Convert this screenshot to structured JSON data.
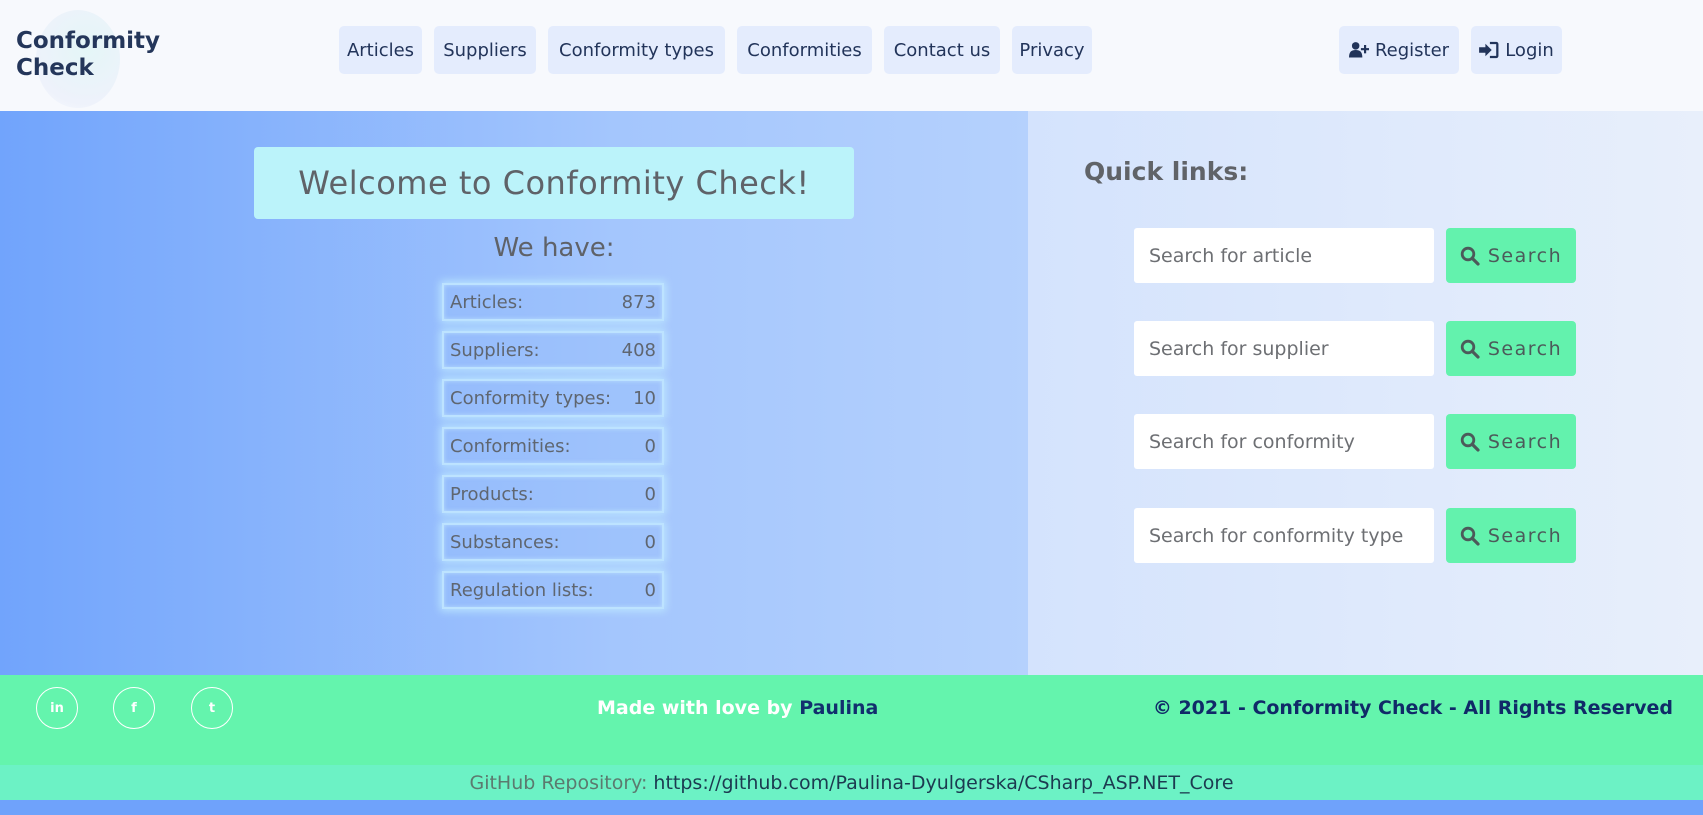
{
  "header": {
    "brand_line1": "Conformity",
    "brand_line2": "Check",
    "nav": [
      "Articles",
      "Suppliers",
      "Conformity types",
      "Conformities",
      "Contact us",
      "Privacy"
    ],
    "register": "Register",
    "login": "Login"
  },
  "hero": {
    "welcome": "Welcome to Conformity Check!",
    "we_have": "We have:",
    "stats": [
      {
        "label": "Articles:",
        "value": "873"
      },
      {
        "label": "Suppliers:",
        "value": "408"
      },
      {
        "label": "Conformity types:",
        "value": "10"
      },
      {
        "label": "Conformities:",
        "value": "0"
      },
      {
        "label": "Products:",
        "value": "0"
      },
      {
        "label": "Substances:",
        "value": "0"
      },
      {
        "label": "Regulation lists:",
        "value": "0"
      }
    ]
  },
  "quick_links": {
    "title": "Quick links:",
    "searches": [
      {
        "placeholder": "Search for article",
        "button": "Search"
      },
      {
        "placeholder": "Search for supplier",
        "button": "Search"
      },
      {
        "placeholder": "Search for conformity",
        "button": "Search"
      },
      {
        "placeholder": "Search for conformity type",
        "button": "Search"
      }
    ]
  },
  "footer": {
    "social": [
      "in",
      "f",
      "t"
    ],
    "made_with_love": "Made with love by",
    "author": "Paulina",
    "copyright": "© 2021 - Conformity Check - All Rights Reserved",
    "github_label": "GitHub Repository:",
    "github_url": "https://github.com/Paulina-Dyulgerska/CSharp_ASP.NET_Core"
  },
  "colors": {
    "accent_green": "#64f4ad",
    "hero_blue": "#71a4fc",
    "navy": "#22345a"
  }
}
